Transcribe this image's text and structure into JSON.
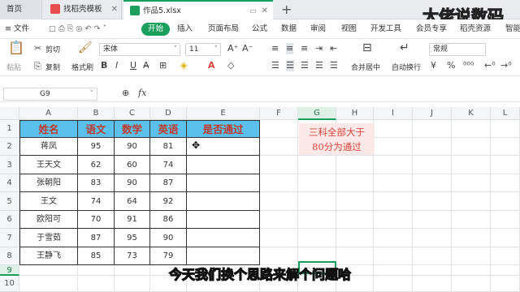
{
  "tabs": [
    {
      "label": "首页"
    },
    {
      "label": "找稻壳模板"
    },
    {
      "label": "作品5.xlsx"
    }
  ],
  "menu": [
    "文件",
    "开始",
    "插入",
    "页面布局",
    "公式",
    "数据",
    "审阅",
    "视图",
    "开发工具",
    "会员专享",
    "稻壳资源",
    "智能工"
  ],
  "toolbar": {
    "cut": "剪切",
    "paste": "粘贴",
    "copy": "复制",
    "format_painter": "格式刷",
    "font": "宋体",
    "font_size": "11",
    "merge": "合并居中",
    "wrap": "自动换行",
    "number_format": "常规"
  },
  "formula_bar": {
    "cell_ref": "G9",
    "fx": "fx",
    "content": ""
  },
  "columns": [
    "A",
    "B",
    "C",
    "D",
    "E",
    "F",
    "G",
    "H",
    "I",
    "J",
    "K",
    "L"
  ],
  "rows": [
    "1",
    "2",
    "3",
    "4",
    "5",
    "6",
    "7",
    "8",
    "9",
    "10"
  ],
  "table": {
    "headers": [
      "姓名",
      "语文",
      "数学",
      "英语",
      "是否通过"
    ],
    "data": [
      [
        "蒋凤",
        "95",
        "90",
        "81",
        ""
      ],
      [
        "王天文",
        "62",
        "60",
        "74",
        ""
      ],
      [
        "张朝阳",
        "83",
        "90",
        "87",
        ""
      ],
      [
        "王文",
        "74",
        "64",
        "92",
        ""
      ],
      [
        "欧阳可",
        "70",
        "91",
        "86",
        ""
      ],
      [
        "于雪茹",
        "87",
        "95",
        "90",
        ""
      ],
      [
        "王静飞",
        "85",
        "73",
        "79",
        ""
      ]
    ]
  },
  "note": {
    "line1": "三科全部大于",
    "line2": "80分为通过"
  },
  "watermark": "大佬说数码",
  "subtitle": "今天我们换个思路来解个问题哈",
  "colors": {
    "accent": "#1aa05c",
    "header_bg": "#5bc0eb",
    "header_text": "#c0392b",
    "note_bg": "#fbe9e7",
    "note_text": "#e0433b"
  }
}
